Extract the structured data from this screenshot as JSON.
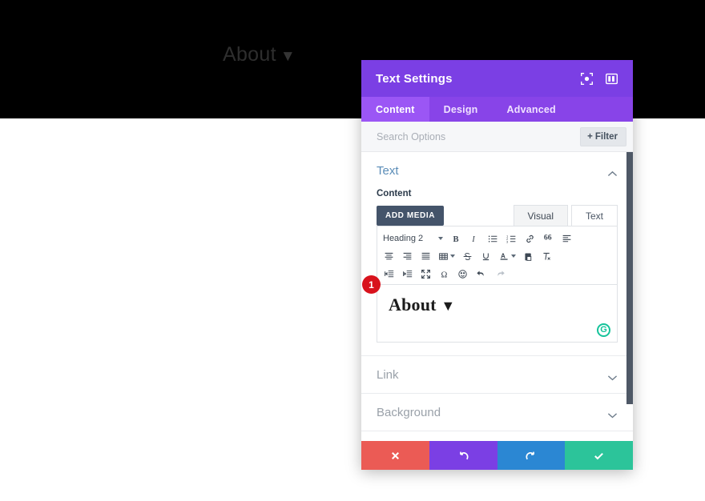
{
  "page": {
    "nav_label": "About",
    "nav_caret": "▼"
  },
  "modal": {
    "title": "Text Settings",
    "header_icons": [
      {
        "name": "focus-icon"
      },
      {
        "name": "panel-layout-icon"
      }
    ],
    "tabs": [
      {
        "label": "Content",
        "active": true
      },
      {
        "label": "Design",
        "active": false
      },
      {
        "label": "Advanced",
        "active": false
      }
    ],
    "search": {
      "placeholder": "Search Options",
      "value": ""
    },
    "filter_button": {
      "plus": "+",
      "label": "Filter"
    },
    "sections": [
      {
        "name": "text",
        "title": "Text",
        "state": "open"
      },
      {
        "name": "link",
        "title": "Link",
        "state": "closed"
      },
      {
        "name": "background",
        "title": "Background",
        "state": "closed"
      }
    ],
    "content_label": "Content",
    "editor": {
      "add_media_label": "ADD MEDIA",
      "mode_tabs": [
        {
          "label": "Visual",
          "active": true
        },
        {
          "label": "Text",
          "active": false
        }
      ],
      "format_select": "Heading 2",
      "toolbar_rows": [
        [
          "bold-icon",
          "italic-icon",
          "bulleted-list-icon",
          "numbered-list-icon",
          "link-icon",
          "blockquote-icon",
          "align-left-icon"
        ],
        [
          "align-center-icon",
          "align-right-icon",
          "justify-icon",
          "table-icon",
          "strikethrough-icon",
          "underline-icon",
          "text-color-icon",
          "paste-as-text-icon",
          "clear-formatting-icon"
        ],
        [
          "outdent-icon",
          "indent-icon",
          "fullscreen-icon",
          "special-character-icon",
          "emoji-icon",
          "undo-icon",
          "redo-icon"
        ]
      ],
      "content_text": "About",
      "content_caret": "▼",
      "grammarly_letter": "G",
      "annotation_badge": "1"
    },
    "actions": [
      {
        "name": "cancel",
        "icon": "close-icon",
        "color": "#eb5b55"
      },
      {
        "name": "undo",
        "icon": "undo-icon",
        "color": "#7b3fe4"
      },
      {
        "name": "redo",
        "icon": "redo-icon",
        "color": "#2b87d3"
      },
      {
        "name": "save",
        "icon": "checkmark-icon",
        "color": "#2cc49a"
      }
    ]
  }
}
